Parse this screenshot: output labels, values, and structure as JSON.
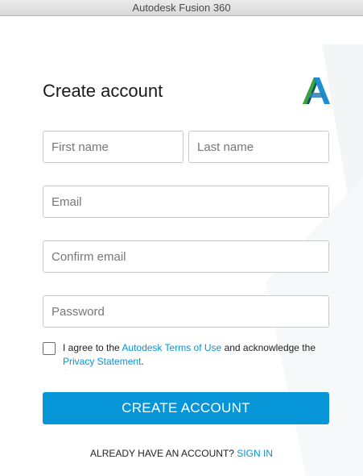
{
  "window": {
    "title": "Autodesk Fusion 360"
  },
  "form": {
    "heading": "Create account",
    "first_name_placeholder": "First name",
    "last_name_placeholder": "Last name",
    "email_placeholder": "Email",
    "confirm_email_placeholder": "Confirm email",
    "password_placeholder": "Password",
    "agree_prefix": "I agree to the ",
    "terms_link": "Autodesk Terms of Use",
    "agree_middle": " and acknowledge the",
    "privacy_link": "Privacy Statement",
    "agree_suffix": ".",
    "create_button": "CREATE ACCOUNT",
    "have_account_text": "ALREADY HAVE AN ACCOUNT? ",
    "sign_in_link": "SIGN IN"
  },
  "colors": {
    "accent": "#0696d7",
    "logo_dark": "#0b4f6c",
    "logo_green": "#3aa537",
    "logo_blue": "#1a8fd1"
  },
  "icons": {
    "logo": "autodesk-logo",
    "checkbox": "checkbox-unchecked"
  }
}
